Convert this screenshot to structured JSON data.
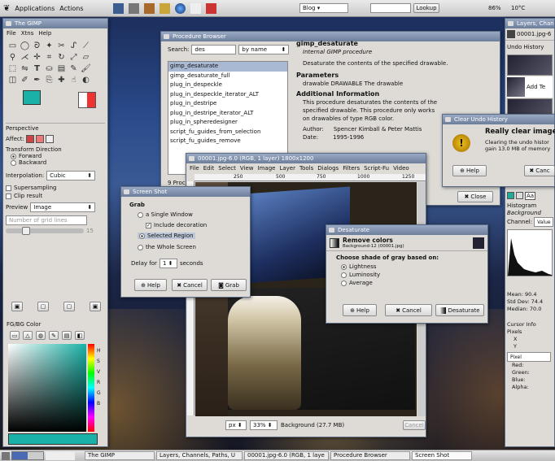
{
  "topbar": {
    "applications": "Applications",
    "actions": "Actions",
    "blog": "Blog",
    "search_value": "",
    "lookup": "Lookup",
    "battery": "86%",
    "temp": "10°C"
  },
  "toolbox": {
    "menu": [
      "File",
      "Xtns",
      "Help"
    ],
    "perspective": "Perspective",
    "affect": "Affect:",
    "transform_direction": "Transform Direction",
    "forward": "Forward",
    "backward": "Backward",
    "interpolation": "Interpolation:",
    "interp_value": "Cubic",
    "supersampling": "Supersampling",
    "clip": "Clip result",
    "preview": "Preview",
    "preview_value": "Image",
    "grid_lines": "Number of grid lines",
    "grid_value": "15",
    "fg_bg": "FG/BG Color"
  },
  "procbrowser": {
    "title": "Procedure Browser",
    "search_label": "Search:",
    "search_value": "des",
    "by": "by name",
    "items": [
      "gimp_desaturate",
      "gimp_desaturate_full",
      "plug_in_despeckle",
      "plug_in_despeckle_iterator_ALT",
      "plug_in_destripe",
      "plug_in_destripe_iterator_ALT",
      "plug_in_spheredesigner",
      "script_fu_guides_from_selection",
      "script_fu_guides_remove"
    ],
    "count": "9 Proce",
    "name": "gimp_desaturate",
    "subtitle": "Internal GIMP procedure",
    "desc": "Desaturate the contents of the specified drawable.",
    "params_h": "Parameters",
    "param_line": "drawable  DRAWABLE  The drawable",
    "addl_h": "Additional Information",
    "addl": "This procedure desaturates the contents of the specified drawable. This procedure only works on drawables of type RGB color.",
    "author_l": "Author:",
    "author": "Spencer Kimball & Peter Mattis",
    "date_l": "Date:",
    "date": "1995-1996",
    "close": "Close"
  },
  "clearundo": {
    "title": "Clear Undo History",
    "heading": "Really clear image's",
    "body": "Clearing the undo histor gain 13.0 MB of memory",
    "help": "Help",
    "cancel": "Canc"
  },
  "layers": {
    "title": "Layers, Chann",
    "image": "00001.jpg-6",
    "undo": "Undo History",
    "add_text": "Add Te",
    "histogram": "Histogram",
    "background": "Background",
    "channel": "Channel:",
    "channel_val": "Value",
    "mean_l": "Mean:",
    "mean": "90.4",
    "std_l": "Std Dev:",
    "std": "74.4",
    "median_l": "Median:",
    "median": "70.0",
    "cursor": "Cursor Info",
    "pixels": "Pixels",
    "x": "X",
    "y": "Y",
    "pixel": "Pixel",
    "red": "Red:",
    "green": "Green:",
    "blue": "Blue:",
    "alpha": "Alpha:"
  },
  "imagewin": {
    "title": "00001.jpg-6.0 (RGB, 1 layer) 1800x1200",
    "menu": [
      "File",
      "Edit",
      "Select",
      "View",
      "Image",
      "Layer",
      "Tools",
      "Dialogs",
      "Filters",
      "Script-Fu",
      "Video"
    ],
    "ruler": [
      "250",
      "500",
      "750",
      "1000",
      "1250"
    ],
    "unit": "px",
    "zoom": "33%",
    "status": "Background (27.7 MB)",
    "cancel": "Cancel"
  },
  "screenshot": {
    "title": "Screen Shot",
    "grab": "Grab",
    "single": "a Single Window",
    "include": "Include decoration",
    "region": "Selected Region",
    "whole": "the Whole Screen",
    "delay": "Delay for",
    "delay_val": "1",
    "seconds": "seconds",
    "help": "Help",
    "cancel": "Cancel",
    "grab_btn": "Grab"
  },
  "removecolors": {
    "title": "Desaturate",
    "heading": "Remove colors",
    "sub": "Background-12 (00001.jpg)",
    "choose": "Choose shade of gray based on:",
    "lightness": "Lightness",
    "luminosity": "Luminosity",
    "average": "Average",
    "help": "Help",
    "cancel": "Cancel",
    "desaturate": "Desaturate"
  },
  "taskbar": [
    "The GIMP",
    "Layers, Channels, Paths, U",
    "00001.jpg-6.0 (RGB, 1 laye",
    "Procedure Browser",
    "Screen Shot"
  ]
}
